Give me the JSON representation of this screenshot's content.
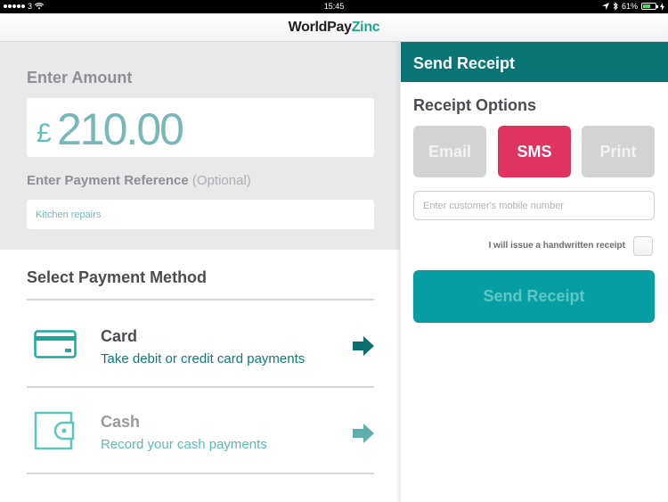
{
  "status_bar": {
    "carrier": "3",
    "time": "15:45",
    "battery_percent": "61%",
    "battery_level": 0.61,
    "icons": [
      "signal-dots-icon",
      "wifi-icon",
      "location-icon",
      "bluetooth-icon",
      "battery-icon",
      "charging-icon"
    ]
  },
  "header": {
    "logo_part1": "WorldPay",
    "logo_part2": "Zinc"
  },
  "amount": {
    "label": "Enter Amount",
    "currency_symbol": "£",
    "value": "210.00"
  },
  "reference": {
    "label": "Enter Payment Reference",
    "optional_label": "(Optional)",
    "value": "Kitchen repairs"
  },
  "payment_method": {
    "title": "Select Payment Method",
    "methods": [
      {
        "name": "Card",
        "description": "Take debit or credit card payments",
        "icon": "credit-card-icon"
      },
      {
        "name": "Cash",
        "description": "Record your cash payments",
        "icon": "wallet-icon"
      }
    ]
  },
  "receipt": {
    "header_title": "Send Receipt",
    "options_title": "Receipt Options",
    "options": [
      "Email",
      "SMS",
      "Print"
    ],
    "selected_option": "SMS",
    "mobile_placeholder": "Enter customer's mobile number",
    "mobile_value": "",
    "handwritten_label": "I will issue a handwritten receipt",
    "handwritten_checked": false,
    "send_button_label": "Send Receipt"
  },
  "colors": {
    "teal_dark": "#0b7474",
    "teal_button": "#069ea3",
    "sms_pink": "#e0335f",
    "inactive_gray": "#d2d3d5",
    "amount_teal": "#7ab7b8"
  }
}
